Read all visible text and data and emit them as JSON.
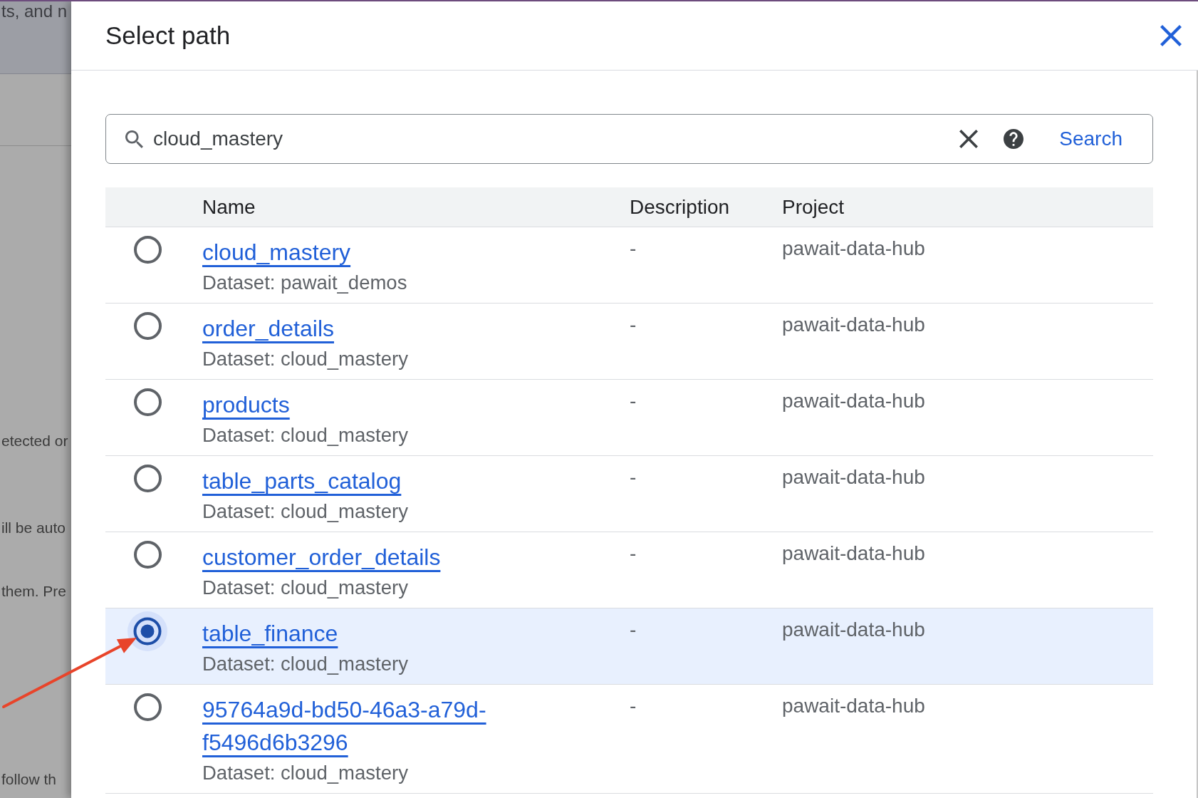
{
  "backdrop": {
    "header_text": "ts, and n",
    "lines": [
      "etected or",
      "ill be auto",
      "them. Pre",
      "follow th"
    ]
  },
  "dialog": {
    "title": "Select path"
  },
  "search": {
    "value": "cloud_mastery",
    "button": "Search"
  },
  "table": {
    "columns": [
      "Name",
      "Description",
      "Project"
    ],
    "rows": [
      {
        "name": "cloud_mastery",
        "dataset": "Dataset: pawait_demos",
        "description": "-",
        "project": "pawait-data-hub",
        "selected": false
      },
      {
        "name": "order_details",
        "dataset": "Dataset: cloud_mastery",
        "description": "-",
        "project": "pawait-data-hub",
        "selected": false
      },
      {
        "name": "products",
        "dataset": "Dataset: cloud_mastery",
        "description": "-",
        "project": "pawait-data-hub",
        "selected": false
      },
      {
        "name": "table_parts_catalog",
        "dataset": "Dataset: cloud_mastery",
        "description": "-",
        "project": "pawait-data-hub",
        "selected": false
      },
      {
        "name": "customer_order_details",
        "dataset": "Dataset: cloud_mastery",
        "description": "-",
        "project": "pawait-data-hub",
        "selected": false
      },
      {
        "name": "table_finance",
        "dataset": "Dataset: cloud_mastery",
        "description": "-",
        "project": "pawait-data-hub",
        "selected": true
      },
      {
        "name": "95764a9d-bd50-46a3-a79d-f5496d6b3296",
        "dataset": "Dataset: cloud_mastery",
        "description": "-",
        "project": "pawait-data-hub",
        "selected": false
      }
    ]
  }
}
